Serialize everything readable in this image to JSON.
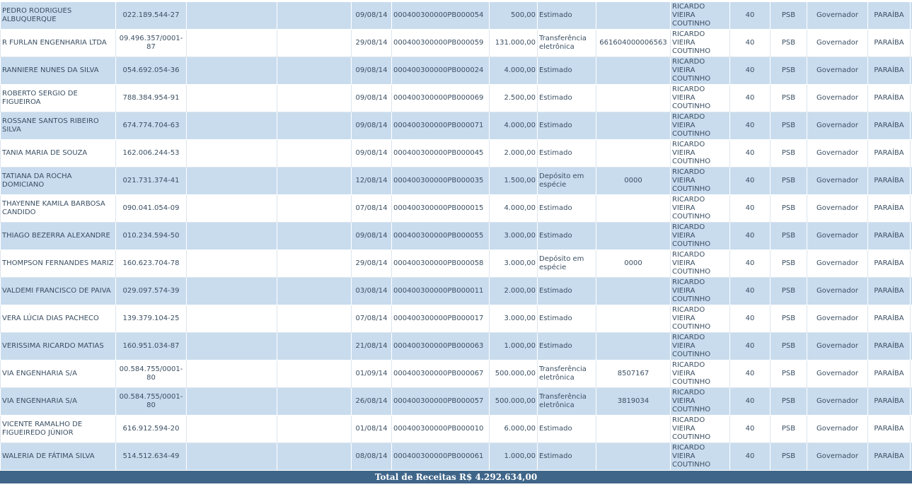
{
  "rows": [
    {
      "nome": "PEDRO RODRIGUES ALBUQUERQUE",
      "cpf": "022.189.544-27",
      "data": "09/08/14",
      "recibo": "000400300000PB000054",
      "valor": "500,00",
      "especie": "Estimado",
      "doc": "",
      "candidato": "RICARDO VIEIRA COUTINHO",
      "numero": "40",
      "partido": "PSB",
      "cargo": "Governador",
      "uf": "PARAÍBA"
    },
    {
      "nome": "R FURLAN ENGENHARIA LTDA",
      "cpf": "09.496.357/0001-87",
      "data": "29/08/14",
      "recibo": "000400300000PB000059",
      "valor": "131.000,00",
      "especie": "Transferência eletrônica",
      "doc": "661604000006563",
      "candidato": "RICARDO VIEIRA COUTINHO",
      "numero": "40",
      "partido": "PSB",
      "cargo": "Governador",
      "uf": "PARAÍBA"
    },
    {
      "nome": "RANNIERE NUNES DA SILVA",
      "cpf": "054.692.054-36",
      "data": "09/08/14",
      "recibo": "000400300000PB000024",
      "valor": "4.000,00",
      "especie": "Estimado",
      "doc": "",
      "candidato": "RICARDO VIEIRA COUTINHO",
      "numero": "40",
      "partido": "PSB",
      "cargo": "Governador",
      "uf": "PARAÍBA"
    },
    {
      "nome": "ROBERTO SERGIO DE FIGUEIROA",
      "cpf": "788.384.954-91",
      "data": "09/08/14",
      "recibo": "000400300000PB000069",
      "valor": "2.500,00",
      "especie": "Estimado",
      "doc": "",
      "candidato": "RICARDO VIEIRA COUTINHO",
      "numero": "40",
      "partido": "PSB",
      "cargo": "Governador",
      "uf": "PARAÍBA"
    },
    {
      "nome": "ROSSANE SANTOS RIBEIRO SILVA",
      "cpf": "674.774.704-63",
      "data": "09/08/14",
      "recibo": "000400300000PB000071",
      "valor": "4.000,00",
      "especie": "Estimado",
      "doc": "",
      "candidato": "RICARDO VIEIRA COUTINHO",
      "numero": "40",
      "partido": "PSB",
      "cargo": "Governador",
      "uf": "PARAÍBA"
    },
    {
      "nome": "TANIA MARIA DE SOUZA",
      "cpf": "162.006.244-53",
      "data": "09/08/14",
      "recibo": "000400300000PB000045",
      "valor": "2.000,00",
      "especie": "Estimado",
      "doc": "",
      "candidato": "RICARDO VIEIRA COUTINHO",
      "numero": "40",
      "partido": "PSB",
      "cargo": "Governador",
      "uf": "PARAÍBA"
    },
    {
      "nome": "TATIANA DA ROCHA DOMICIANO",
      "cpf": "021.731.374-41",
      "data": "12/08/14",
      "recibo": "000400300000PB000035",
      "valor": "1.500,00",
      "especie": "Depósito em espécie",
      "doc": "0000",
      "candidato": "RICARDO VIEIRA COUTINHO",
      "numero": "40",
      "partido": "PSB",
      "cargo": "Governador",
      "uf": "PARAÍBA"
    },
    {
      "nome": "THAYENNE KAMILA BARBOSA CANDIDO",
      "cpf": "090.041.054-09",
      "data": "07/08/14",
      "recibo": "000400300000PB000015",
      "valor": "4.000,00",
      "especie": "Estimado",
      "doc": "",
      "candidato": "RICARDO VIEIRA COUTINHO",
      "numero": "40",
      "partido": "PSB",
      "cargo": "Governador",
      "uf": "PARAÍBA"
    },
    {
      "nome": "THIAGO BEZERRA ALEXANDRE",
      "cpf": "010.234.594-50",
      "data": "09/08/14",
      "recibo": "000400300000PB000055",
      "valor": "3.000,00",
      "especie": "Estimado",
      "doc": "",
      "candidato": "RICARDO VIEIRA COUTINHO",
      "numero": "40",
      "partido": "PSB",
      "cargo": "Governador",
      "uf": "PARAÍBA"
    },
    {
      "nome": "THOMPSON FERNANDES MARIZ",
      "cpf": "160.623.704-78",
      "data": "29/08/14",
      "recibo": "000400300000PB000058",
      "valor": "3.000,00",
      "especie": "Depósito em espécie",
      "doc": "0000",
      "candidato": "RICARDO VIEIRA COUTINHO",
      "numero": "40",
      "partido": "PSB",
      "cargo": "Governador",
      "uf": "PARAÍBA"
    },
    {
      "nome": "VALDEMI FRANCISCO DE PAIVA",
      "cpf": "029.097.574-39",
      "data": "03/08/14",
      "recibo": "000400300000PB000011",
      "valor": "2.000,00",
      "especie": "Estimado",
      "doc": "",
      "candidato": "RICARDO VIEIRA COUTINHO",
      "numero": "40",
      "partido": "PSB",
      "cargo": "Governador",
      "uf": "PARAÍBA"
    },
    {
      "nome": "VERA LÚCIA DIAS PACHECO",
      "cpf": "139.379.104-25",
      "data": "07/08/14",
      "recibo": "000400300000PB000017",
      "valor": "3.000,00",
      "especie": "Estimado",
      "doc": "",
      "candidato": "RICARDO VIEIRA COUTINHO",
      "numero": "40",
      "partido": "PSB",
      "cargo": "Governador",
      "uf": "PARAÍBA"
    },
    {
      "nome": "VERISSIMA RICARDO MATIAS",
      "cpf": "160.951.034-87",
      "data": "21/08/14",
      "recibo": "000400300000PB000063",
      "valor": "1.000,00",
      "especie": "Estimado",
      "doc": "",
      "candidato": "RICARDO VIEIRA COUTINHO",
      "numero": "40",
      "partido": "PSB",
      "cargo": "Governador",
      "uf": "PARAÍBA"
    },
    {
      "nome": "VIA ENGENHARIA S/A",
      "cpf": "00.584.755/0001-80",
      "data": "01/09/14",
      "recibo": "000400300000PB000067",
      "valor": "500.000,00",
      "especie": "Transferência eletrônica",
      "doc": "8507167",
      "candidato": "RICARDO VIEIRA COUTINHO",
      "numero": "40",
      "partido": "PSB",
      "cargo": "Governador",
      "uf": "PARAÍBA"
    },
    {
      "nome": "VIA ENGENHARIA S/A",
      "cpf": "00.584.755/0001-80",
      "data": "26/08/14",
      "recibo": "000400300000PB000057",
      "valor": "500.000,00",
      "especie": "Transferência eletrônica",
      "doc": "3819034",
      "candidato": "RICARDO VIEIRA COUTINHO",
      "numero": "40",
      "partido": "PSB",
      "cargo": "Governador",
      "uf": "PARAÍBA"
    },
    {
      "nome": "VICENTE RAMALHO DE FIGUEIREDO JÚNIOR",
      "cpf": "616.912.594-20",
      "data": "01/08/14",
      "recibo": "000400300000PB000010",
      "valor": "6.000,00",
      "especie": "Estimado",
      "doc": "",
      "candidato": "RICARDO VIEIRA COUTINHO",
      "numero": "40",
      "partido": "PSB",
      "cargo": "Governador",
      "uf": "PARAÍBA"
    },
    {
      "nome": "WALERIA DE FÁTIMA SILVA",
      "cpf": "514.512.634-49",
      "data": "08/08/14",
      "recibo": "000400300000PB000061",
      "valor": "1.000,00",
      "especie": "Estimado",
      "doc": "",
      "candidato": "RICARDO VIEIRA COUTINHO",
      "numero": "40",
      "partido": "PSB",
      "cargo": "Governador",
      "uf": "PARAÍBA"
    }
  ],
  "footer": {
    "total_label": "Total de Receitas R$ 4.292.634,00"
  },
  "colors": {
    "row_alt": "#c9dcee",
    "row_plain": "#ffffff",
    "total_bar": "#3f6589",
    "text": "#3a4f63"
  }
}
